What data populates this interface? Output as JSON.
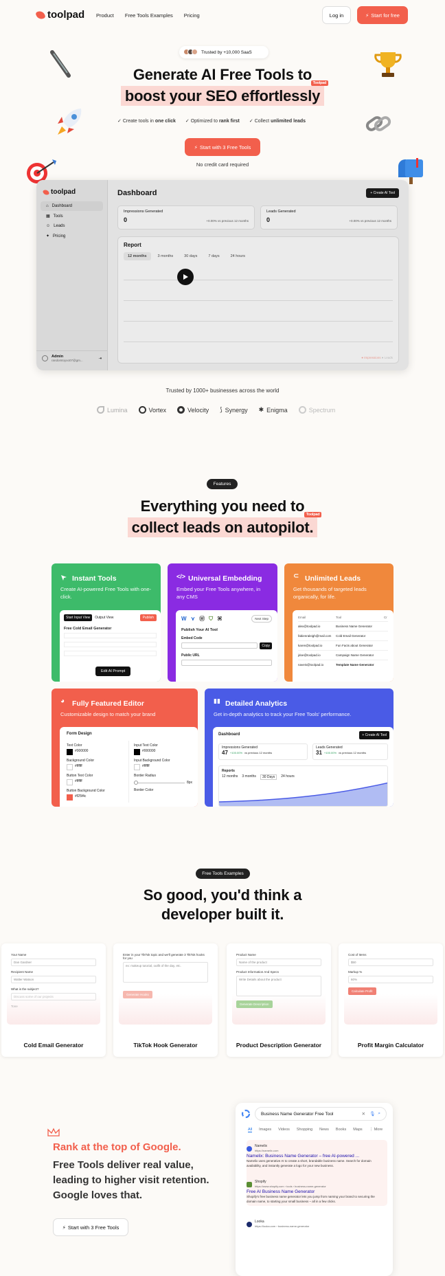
{
  "nav": {
    "brand": "toolpad",
    "links": [
      "Product",
      "Free Tools Examples",
      "Pricing"
    ],
    "login": "Log in",
    "start": "Start for free"
  },
  "hero": {
    "trusted_pill": "Trusted by +10,000 SaaS",
    "title_line1": "Generate AI Free Tools to",
    "title_line2": "boost your SEO effortlessly",
    "tag": "Toolpad",
    "checks": [
      {
        "pre": "Create tools in ",
        "bold": "one click"
      },
      {
        "pre": "Optimized to ",
        "bold": "rank first"
      },
      {
        "pre": "Collect ",
        "bold": "unlimited leads"
      }
    ],
    "cta": "Start with 3 Free Tools",
    "no_cc": "No credit card required"
  },
  "dashboard": {
    "brand": "toolpad",
    "sidebar": [
      "Dashboard",
      "Tools",
      "Leads",
      "Pricing"
    ],
    "title": "Dashboard",
    "create_btn": "+ Create AI Tool",
    "stats": [
      {
        "label": "Impressions Generated",
        "value": "0",
        "delta": "+0.00%",
        "note": "vs previous 12 months"
      },
      {
        "label": "Leads Generated",
        "value": "0",
        "delta": "+0.00%",
        "note": "vs previous 12 months"
      }
    ],
    "report_title": "Report",
    "report_tabs": [
      "12 months",
      "3 months",
      "30 days",
      "7 days",
      "24 hours"
    ],
    "legend": [
      "Impressions",
      "Leads"
    ],
    "user_name": "Admin",
    "user_email": "randomtoyxo07@gm..."
  },
  "trusted": {
    "label": "Trusted by 1000+ businesses across the world",
    "logos": [
      "Lumina",
      "Vortex",
      "Velocity",
      "Synergy",
      "Enigma",
      "Spectrum"
    ]
  },
  "features": {
    "pill": "Features",
    "title_line1": "Everything you need to",
    "title_line2": "collect leads on autopilot.",
    "tag": "Toolpad",
    "cards": [
      {
        "title": "Instant Tools",
        "desc": "Create AI-powered Free Tools with one-click.",
        "color": "#3dbb6a"
      },
      {
        "title": "Universal Embedding",
        "desc": "Embed your Free Tools anywhere, in any CMS",
        "color": "#8a2be2"
      },
      {
        "title": "Unlimited Leads",
        "desc": "Get thousands of targeted leads organically, for life.",
        "color": "#f0883c"
      },
      {
        "title": "Fully Featured Editor",
        "desc": "Customizable design to match your brand",
        "color": "#f25f4c"
      },
      {
        "title": "Detailed Analytics",
        "desc": "Get in-depth analytics to track your Free Tools' performance.",
        "color": "#4a5be6"
      }
    ],
    "instant": {
      "tab1": "Start Input View",
      "tab2": "Output View",
      "publish": "Publish",
      "tool": "Free Cold Email Generator",
      "btn": "Edit AI Prompt"
    },
    "embed": {
      "publish": "Publish Your AI Tool",
      "embed": "Embed Code",
      "copy": "Copy",
      "url": "Public URL",
      "next": "Next Step"
    },
    "leads": {
      "cols": [
        "Email",
        "Tool",
        "Cr"
      ],
      "rows": [
        [
          "alex@toolpad.io",
          "Business Name Generator"
        ],
        [
          "fabienraleigh@mail.com",
          "Cold Email Generator"
        ],
        [
          "karen@toolpad.io",
          "Fun Facts about Generator"
        ],
        [
          "jdoe@toolpad.io",
          "Campaign Name Generator"
        ],
        [
          "naveis@toolpad.io",
          "Template Name Generator"
        ]
      ]
    },
    "editor": {
      "heading": "Form Design",
      "fields": [
        {
          "label": "Text Color",
          "value": "#000000"
        },
        {
          "label": "Background Color",
          "value": "#ffffff"
        },
        {
          "label": "Button Text Color",
          "value": "#ffffff"
        },
        {
          "label": "Button Background Color",
          "value": "#f25f4c"
        }
      ],
      "fields_right": [
        {
          "label": "Input Text Color",
          "value": "#000000"
        },
        {
          "label": "Input Background Color",
          "value": "#ffffff"
        },
        {
          "label": "Border Radius",
          "value": "8px"
        },
        {
          "label": "Border Color",
          "value": ""
        }
      ]
    },
    "analytics": {
      "title": "Dashboard",
      "btn": "+ Create AI Tool",
      "stats": [
        {
          "label": "Impressions Generated",
          "value": "47",
          "delta": "+100.00%",
          "note": "vs previous 12 months"
        },
        {
          "label": "Leads Generated",
          "value": "31",
          "delta": "+100.00%",
          "note": "vs previous 12 months"
        }
      ],
      "report": "Reports",
      "tabs": [
        "12 months",
        "3 months",
        "30 Days",
        "24 hours"
      ]
    }
  },
  "examples": {
    "pill": "Free Tools Examples",
    "title_line1": "So good, you'd think a",
    "title_line2": "developer built it.",
    "cards": [
      {
        "title": "Cold Email Generator",
        "fields": [
          {
            "label": "Your Name",
            "value": "Dan Gardner"
          },
          {
            "label": "Recipient Name",
            "value": "Walter Watson"
          },
          {
            "label": "What is the subject?",
            "value": "Discuss some of our projects"
          }
        ],
        "extra": "Tone"
      },
      {
        "title": "TikTok Hook Generator",
        "fields": [
          {
            "label": "Enter in your TikTok topic and we'll generate 3 TikTok hooks for you",
            "value": "ex: makeup tutorial, outfit of the day, etc."
          }
        ],
        "button": "Generate Hooks"
      },
      {
        "title": "Product Description Generator",
        "fields": [
          {
            "label": "Product Name",
            "value": "Name of the product"
          },
          {
            "label": "Product Information And Specs",
            "value": "Write Details about the product"
          }
        ],
        "button": "Generate Description"
      },
      {
        "title": "Profit Margin Calculator",
        "fields": [
          {
            "label": "Cost of Items",
            "value": "$50"
          },
          {
            "label": "Markup %",
            "value": "60%"
          }
        ],
        "button": "Calculate Profit"
      }
    ]
  },
  "seo": {
    "heading": "Rank at the top of Google.",
    "body": "Free Tools deliver real value, leading to higher visit retention. Google loves that.",
    "cta": "Start with 3 Free Tools",
    "search_query": "Business Name Generator Free Tool",
    "tabs": [
      "All",
      "Images",
      "Videos",
      "Shopping",
      "News",
      "Books",
      "Maps",
      "More"
    ],
    "results": [
      {
        "site": "Namelix",
        "url": "https://namelix.com",
        "title": "Namelix: Business Name Generator – free AI-powered ...",
        "snippet": "Namelix uses generative AI to create a short, brandable business name. Search for domain availability, and instantly generate a logo for your new business."
      },
      {
        "site": "Shopify",
        "url": "https://www.shopify.com › tools › business-name-generator",
        "title": "Free AI Business Name Generator",
        "snippet": "Shopify's free business name generator lets you jump from naming your brand to securing the domain name, to starting your small business – all in a few clicks."
      },
      {
        "site": "Looka",
        "url": "https://looka.com › business-name-generator",
        "title": "",
        "snippet": ""
      }
    ]
  }
}
